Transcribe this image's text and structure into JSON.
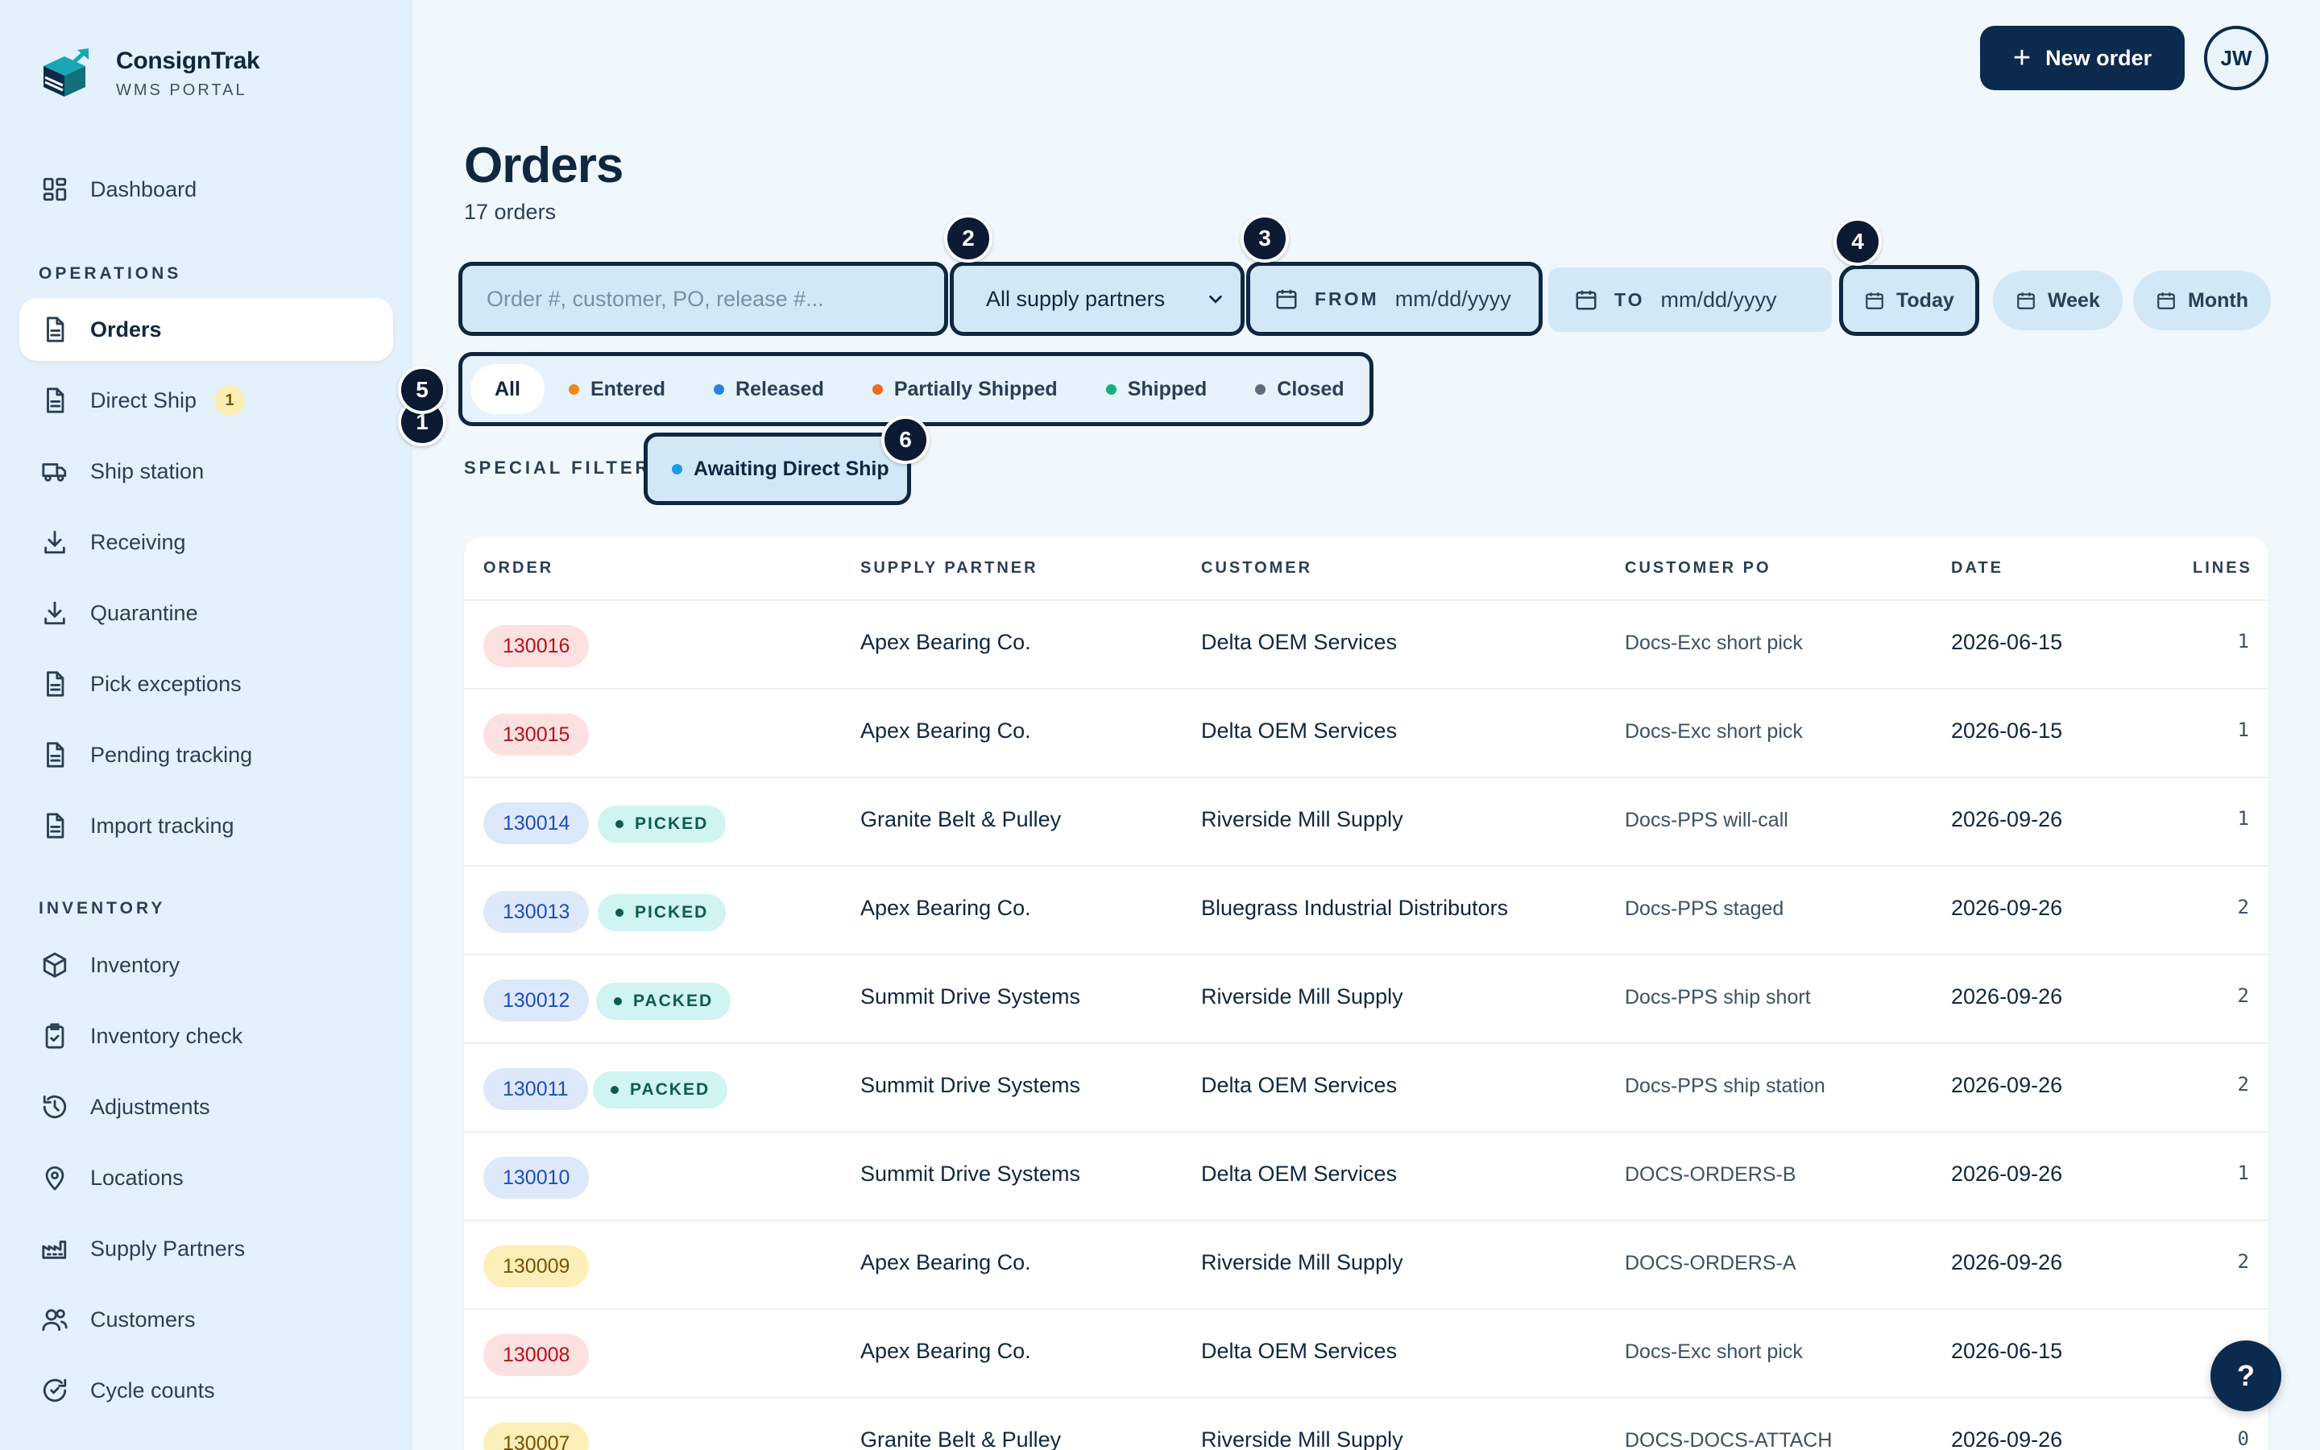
{
  "brand": {
    "name": "ConsignTrak",
    "subtitle": "WMS PORTAL"
  },
  "sidebar": {
    "dashboard": "Dashboard",
    "operations_title": "OPERATIONS",
    "operations": [
      {
        "label": "Orders",
        "icon": "document-icon",
        "active": true
      },
      {
        "label": "Direct Ship",
        "icon": "document-icon",
        "badge": "1"
      },
      {
        "label": "Ship station",
        "icon": "truck-icon"
      },
      {
        "label": "Receiving",
        "icon": "download-icon"
      },
      {
        "label": "Quarantine",
        "icon": "download-icon"
      },
      {
        "label": "Pick exceptions",
        "icon": "document-icon"
      },
      {
        "label": "Pending tracking",
        "icon": "document-icon"
      },
      {
        "label": "Import tracking",
        "icon": "document-icon"
      }
    ],
    "inventory_title": "INVENTORY",
    "inventory": [
      {
        "label": "Inventory",
        "icon": "box-icon"
      },
      {
        "label": "Inventory check",
        "icon": "clipboard-check-icon"
      },
      {
        "label": "Adjustments",
        "icon": "history-icon"
      },
      {
        "label": "Locations",
        "icon": "map-pin-icon"
      },
      {
        "label": "Supply Partners",
        "icon": "factory-icon"
      },
      {
        "label": "Customers",
        "icon": "users-icon"
      },
      {
        "label": "Cycle counts",
        "icon": "refresh-icon"
      }
    ]
  },
  "header": {
    "new_order": "New order",
    "avatar_initials": "JW"
  },
  "page": {
    "title": "Orders",
    "count": "17 orders"
  },
  "filters": {
    "search_placeholder": "Order #, customer, PO, release #...",
    "partner_select": "All supply partners",
    "from_label": "FROM",
    "from_value": "mm/dd/yyyy",
    "to_label": "TO",
    "to_value": "mm/dd/yyyy",
    "today": "Today",
    "week": "Week",
    "month": "Month",
    "statuses": [
      {
        "label": "All",
        "color": ""
      },
      {
        "label": "Entered",
        "color": "#f08a14"
      },
      {
        "label": "Released",
        "color": "#2f7fe0"
      },
      {
        "label": "Partially Shipped",
        "color": "#f06a1a"
      },
      {
        "label": "Shipped",
        "color": "#15b07a"
      },
      {
        "label": "Closed",
        "color": "#5d6b7a"
      }
    ],
    "special_label": "SPECIAL FILTERS",
    "special_chip": "Awaiting Direct Ship",
    "special_chip_color": "#1a9be6"
  },
  "markers": [
    "1",
    "2",
    "3",
    "4",
    "5",
    "6"
  ],
  "table": {
    "headers": {
      "order": "ORDER",
      "partner": "SUPPLY PARTNER",
      "customer": "CUSTOMER",
      "po": "CUSTOMER PO",
      "date": "DATE",
      "lines": "LINES"
    },
    "rows": [
      {
        "order": "130016",
        "tone": "red",
        "tag": "",
        "partner": "Apex Bearing Co.",
        "customer": "Delta OEM Services",
        "po": "Docs-Exc short pick",
        "date": "2026-06-15",
        "lines": "1"
      },
      {
        "order": "130015",
        "tone": "red",
        "tag": "",
        "partner": "Apex Bearing Co.",
        "customer": "Delta OEM Services",
        "po": "Docs-Exc short pick",
        "date": "2026-06-15",
        "lines": "1"
      },
      {
        "order": "130014",
        "tone": "blue",
        "tag": "PICKED",
        "partner": "Granite Belt & Pulley",
        "customer": "Riverside Mill Supply",
        "po": "Docs-PPS will-call",
        "date": "2026-09-26",
        "lines": "1"
      },
      {
        "order": "130013",
        "tone": "blue",
        "tag": "PICKED",
        "partner": "Apex Bearing Co.",
        "customer": "Bluegrass Industrial Distributors",
        "po": "Docs-PPS staged",
        "date": "2026-09-26",
        "lines": "2"
      },
      {
        "order": "130012",
        "tone": "blue",
        "tag": "PACKED",
        "partner": "Summit Drive Systems",
        "customer": "Riverside Mill Supply",
        "po": "Docs-PPS ship short",
        "date": "2026-09-26",
        "lines": "2"
      },
      {
        "order": "130011",
        "tone": "blue",
        "tag": "PACKED",
        "partner": "Summit Drive Systems",
        "customer": "Delta OEM Services",
        "po": "Docs-PPS ship station",
        "date": "2026-09-26",
        "lines": "2"
      },
      {
        "order": "130010",
        "tone": "blue",
        "tag": "",
        "partner": "Summit Drive Systems",
        "customer": "Delta OEM Services",
        "po": "DOCS-ORDERS-B",
        "date": "2026-09-26",
        "lines": "1"
      },
      {
        "order": "130009",
        "tone": "yellow",
        "tag": "",
        "partner": "Apex Bearing Co.",
        "customer": "Riverside Mill Supply",
        "po": "DOCS-ORDERS-A",
        "date": "2026-09-26",
        "lines": "2"
      },
      {
        "order": "130008",
        "tone": "red",
        "tag": "",
        "partner": "Apex Bearing Co.",
        "customer": "Delta OEM Services",
        "po": "Docs-Exc short pick",
        "date": "2026-06-15",
        "lines": ""
      },
      {
        "order": "130007",
        "tone": "yellow",
        "tag": "",
        "partner": "Granite Belt & Pulley",
        "customer": "Riverside Mill Supply",
        "po": "DOCS-DOCS-ATTACH",
        "date": "2026-09-26",
        "lines": "0"
      }
    ]
  },
  "help": "?",
  "colors": {
    "pill_red_bg": "#fde0e0",
    "pill_red_fg": "#b3121b",
    "pill_blue_bg": "#dde8fb",
    "pill_blue_fg": "#1d4fb8",
    "pill_yellow_bg": "#fdefb8",
    "pill_yellow_fg": "#7a5200"
  }
}
